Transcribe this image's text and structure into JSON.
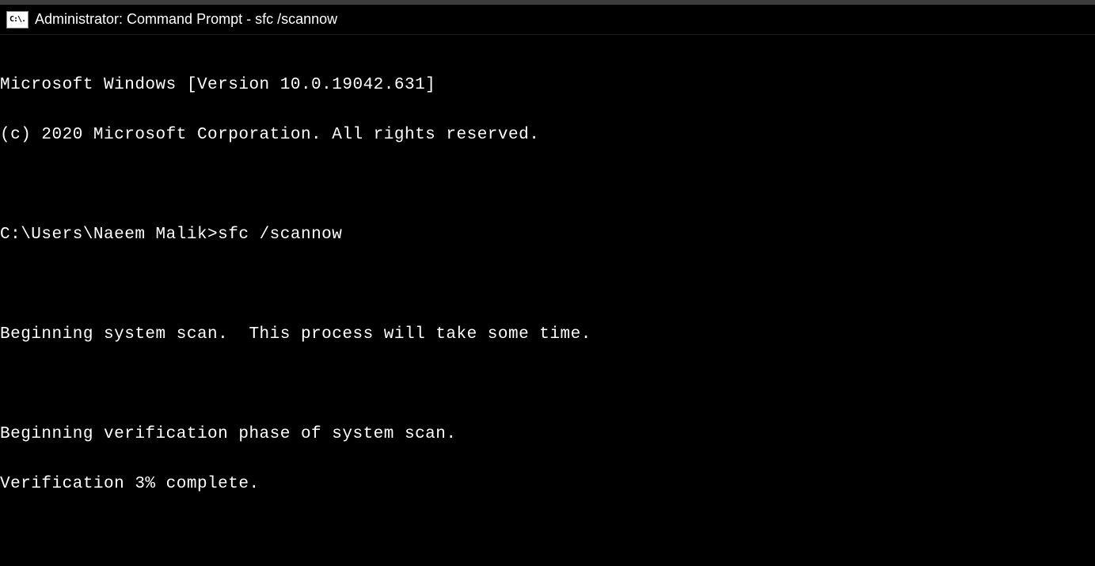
{
  "titlebar": {
    "icon_label": "C:\\.",
    "title": "Administrator: Command Prompt - sfc  /scannow"
  },
  "terminal": {
    "banner_line1": "Microsoft Windows [Version 10.0.19042.631]",
    "banner_line2": "(c) 2020 Microsoft Corporation. All rights reserved.",
    "prompt": "C:\\Users\\Naeem Malik>",
    "command": "sfc /scannow",
    "output_line1": "Beginning system scan.  This process will take some time.",
    "output_line2": "Beginning verification phase of system scan.",
    "output_line3": "Verification 3% complete."
  }
}
